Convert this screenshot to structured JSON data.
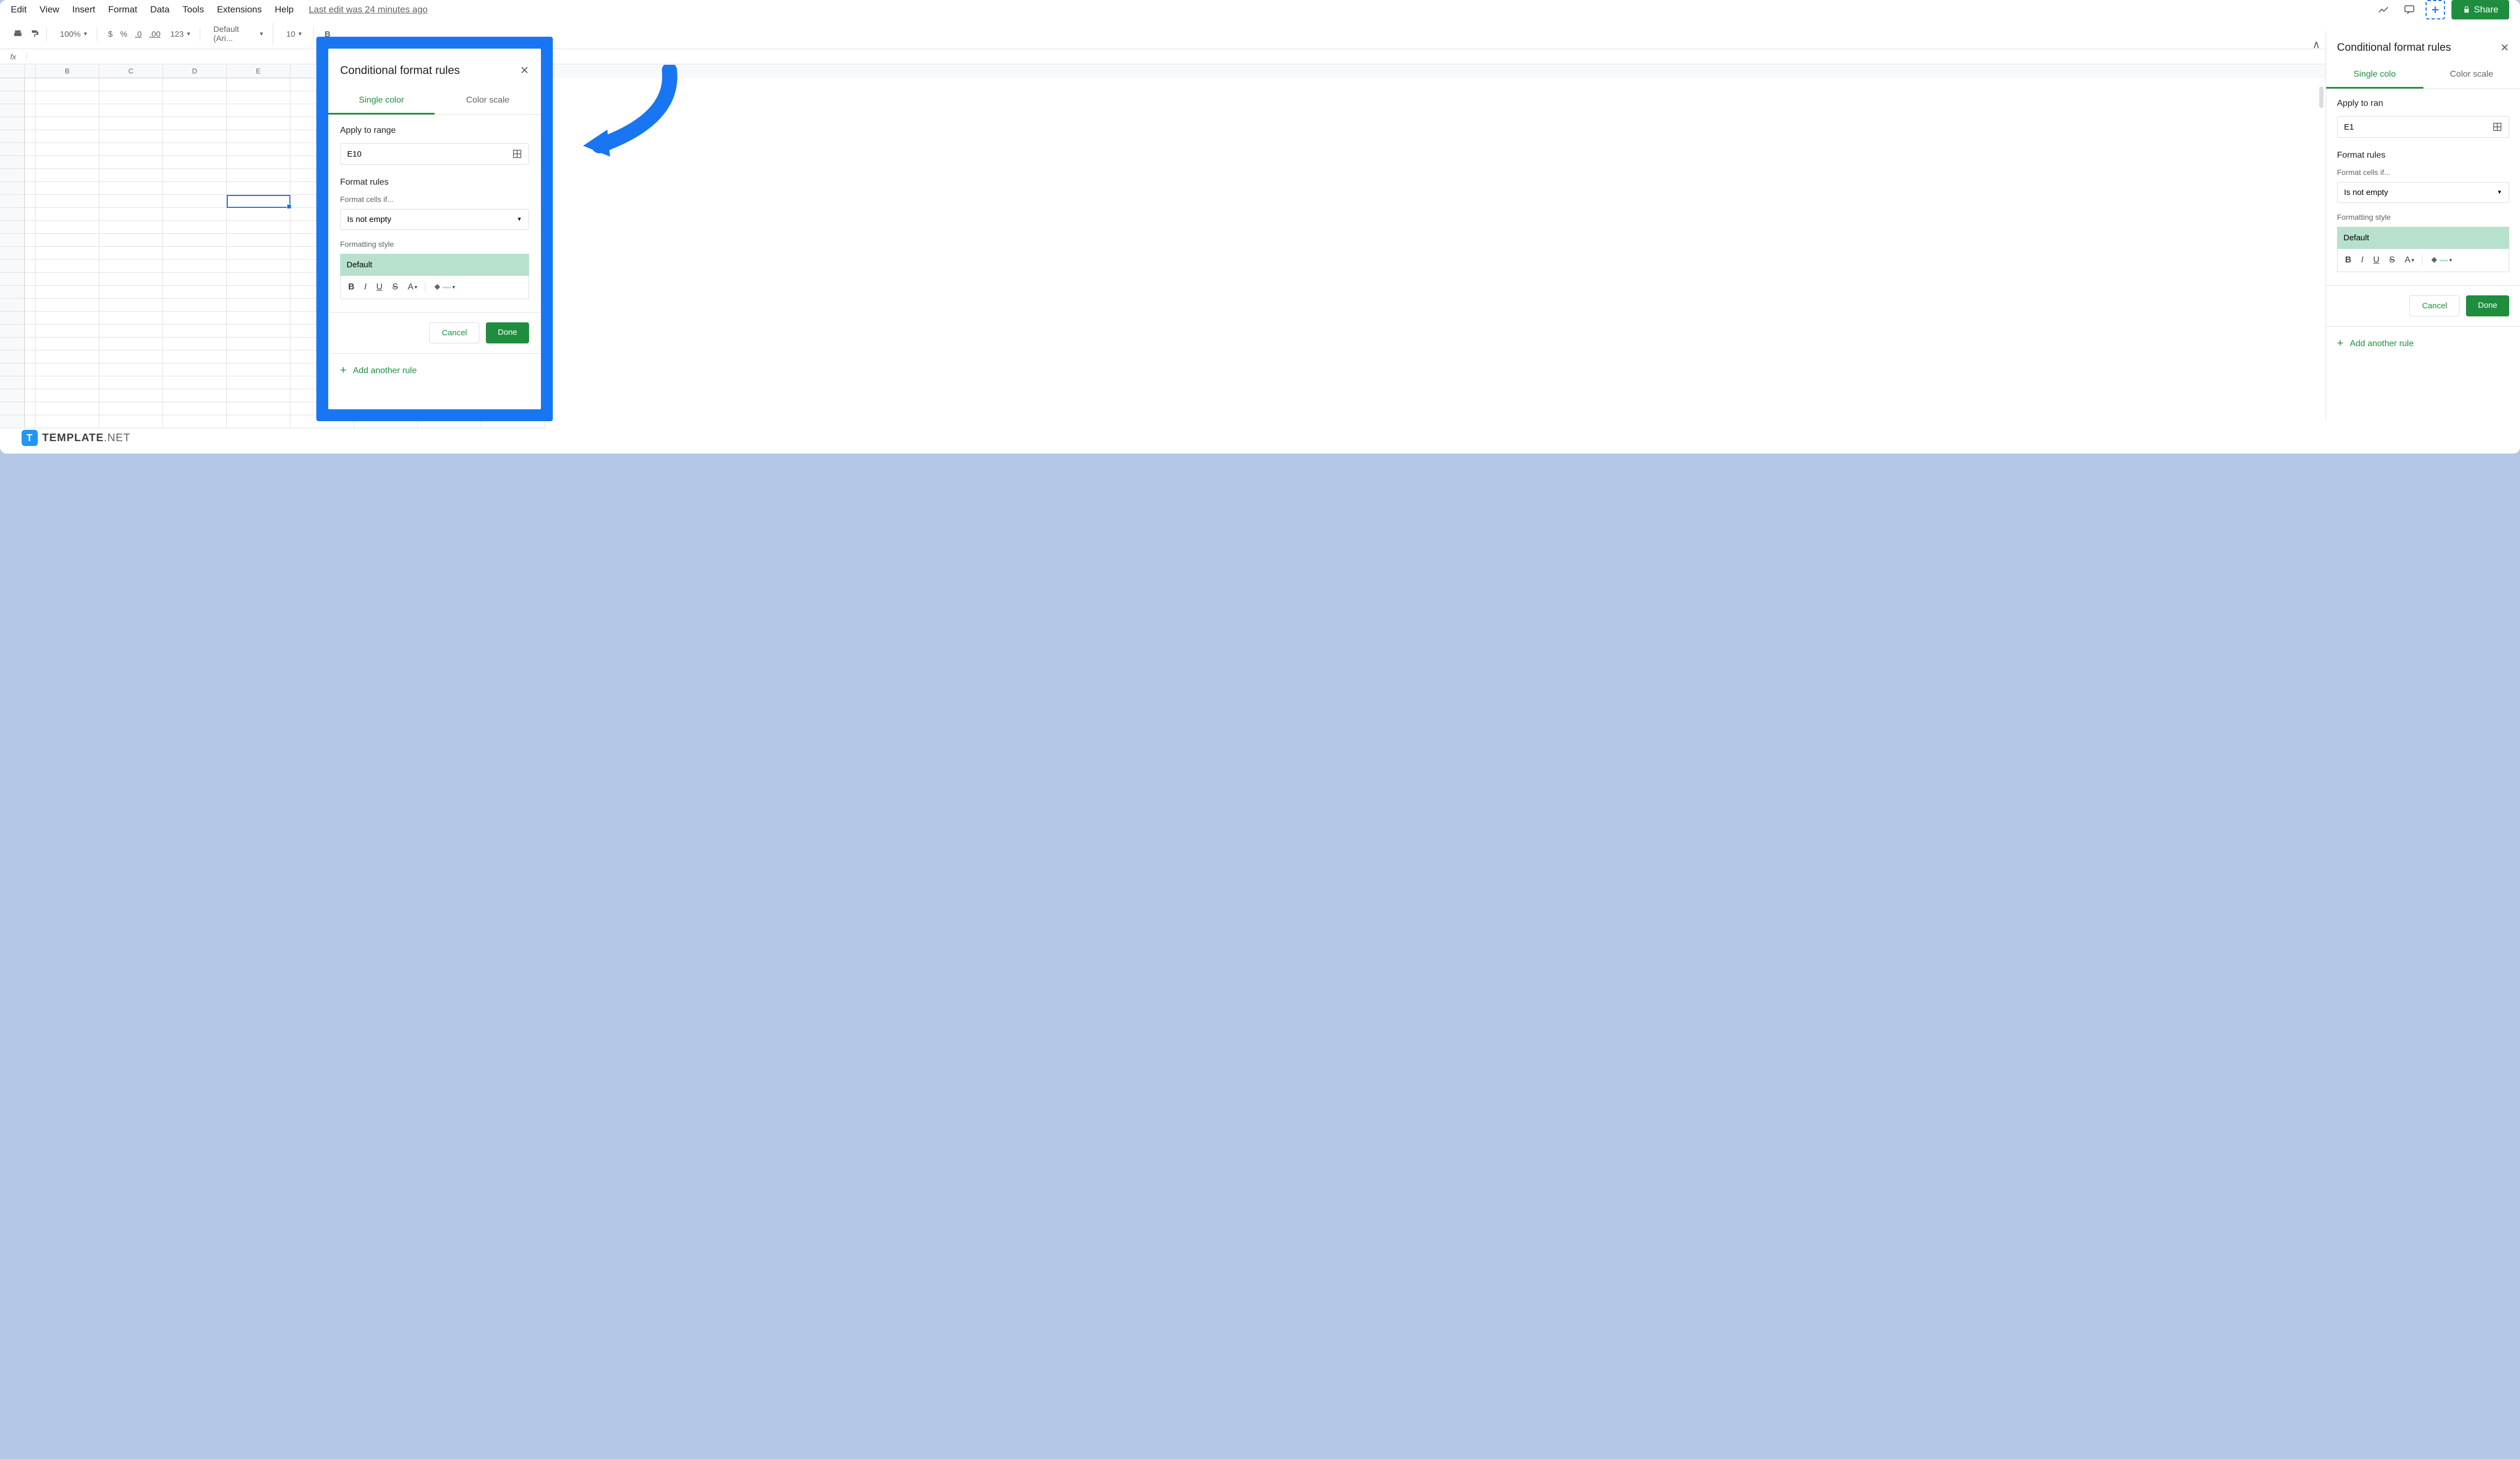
{
  "menubar": {
    "items": [
      "Edit",
      "View",
      "Insert",
      "Format",
      "Data",
      "Tools",
      "Extensions",
      "Help"
    ],
    "last_edit": "Last edit was 24 minutes ago"
  },
  "toolbar": {
    "zoom": "100%",
    "currency": "$",
    "percent": "%",
    "dec_dec": ".0",
    "inc_dec": ".00",
    "num_format": "123",
    "font": "Default (Ari...",
    "font_size": "10",
    "bold": "B"
  },
  "share_label": "Share",
  "formula_fx": "fx",
  "columns": [
    "B",
    "C",
    "D",
    "E"
  ],
  "selected_cell": "E10",
  "panel": {
    "title": "Conditional format rules",
    "tabs": {
      "single": "Single color",
      "scale": "Color scale"
    },
    "apply_range_label": "Apply to range",
    "range_value": "E10",
    "range_value_partial": "E1",
    "format_rules_label": "Format rules",
    "format_cells_if_label": "Format cells if...",
    "condition": "Is not empty",
    "formatting_style_label": "Formatting style",
    "style_preview": "Default",
    "cancel": "Cancel",
    "done": "Done",
    "add_rule": "Add another rule"
  },
  "zoom_panel_tab_partial": "Single colo",
  "apply_range_partial": "Apply to ran",
  "logo": {
    "t": "T",
    "bold": "TEMPLATE",
    "thin": ".NET"
  }
}
